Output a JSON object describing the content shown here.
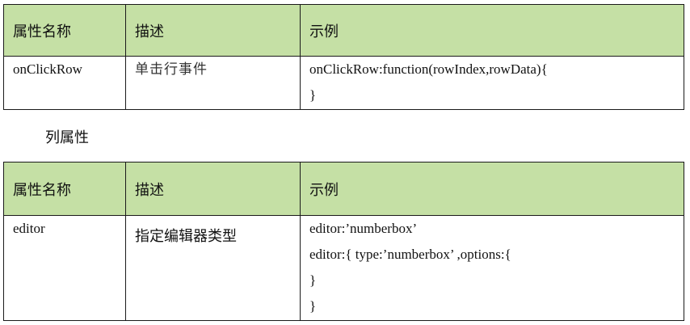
{
  "table1": {
    "headers": [
      "属性名称",
      "描述",
      "示例"
    ],
    "row": {
      "name": "onClickRow",
      "description": "单击行事件",
      "example_lines": [
        "onClickRow:function(rowIndex,rowData){",
        "}"
      ]
    }
  },
  "section_title": "列属性",
  "table2": {
    "headers": [
      "属性名称",
      "描述",
      "示例"
    ],
    "row": {
      "name": "editor",
      "description": "指定编辑器类型",
      "example_lines": [
        "editor:’numberbox’",
        "editor:{ type:’numberbox’ ,options:{",
        "}",
        "}"
      ]
    }
  }
}
